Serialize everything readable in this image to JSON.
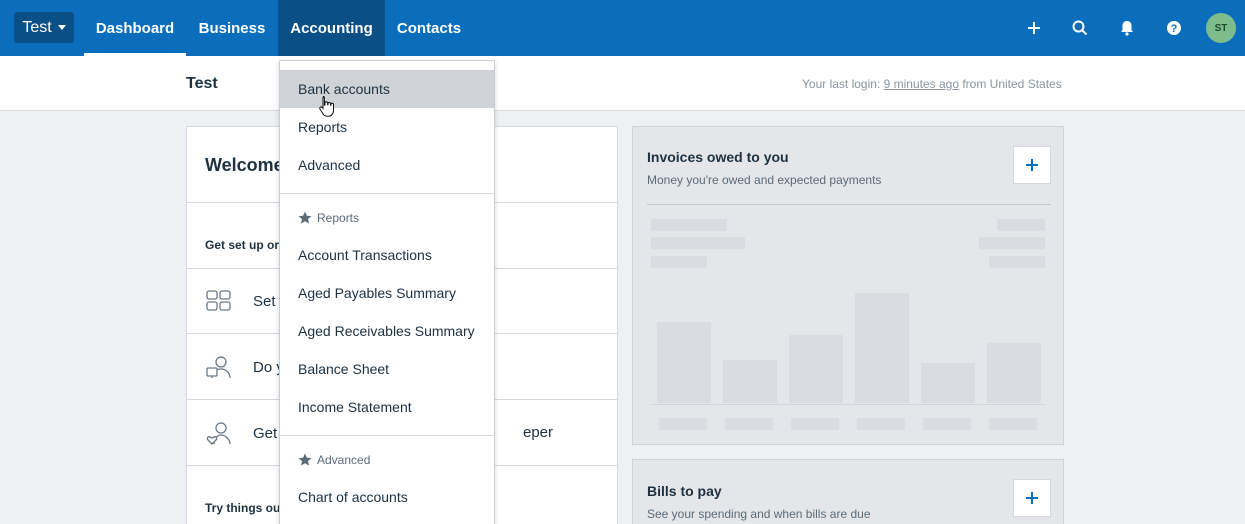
{
  "nav": {
    "org": "Test",
    "tabs": [
      "Dashboard",
      "Business",
      "Accounting",
      "Contacts"
    ],
    "avatar_initials": "ST",
    "icons": [
      "plus-icon",
      "search-icon",
      "bell-icon",
      "help-icon"
    ]
  },
  "subheader": {
    "org_name": "Test",
    "login_prefix": "Your last login: ",
    "login_link": "9 minutes ago",
    "login_suffix": " from United States"
  },
  "welcome": {
    "title": "Welcome",
    "setup_heading": "Get set up or",
    "items": [
      "Set u",
      "Do y",
      "Get"
    ],
    "tail_text": "eper",
    "try_heading": "Try things ou"
  },
  "invoices": {
    "title": "Invoices owed to you",
    "subtitle": "Money you're owed and expected payments"
  },
  "bills": {
    "title": "Bills to pay",
    "subtitle": "See your spending and when bills are due"
  },
  "dropdown": {
    "top_items": [
      "Bank accounts",
      "Reports",
      "Advanced"
    ],
    "reports_heading": "Reports",
    "report_items": [
      "Account Transactions",
      "Aged Payables Summary",
      "Aged Receivables Summary",
      "Balance Sheet",
      "Income Statement"
    ],
    "advanced_heading": "Advanced",
    "advanced_items": [
      "Chart of accounts"
    ]
  },
  "colors": {
    "nav_blue": "#0a6ebd",
    "nav_dark": "#0b4f87",
    "hover_row": "#cfd3d7",
    "avatar_green": "#7dbd8c"
  }
}
